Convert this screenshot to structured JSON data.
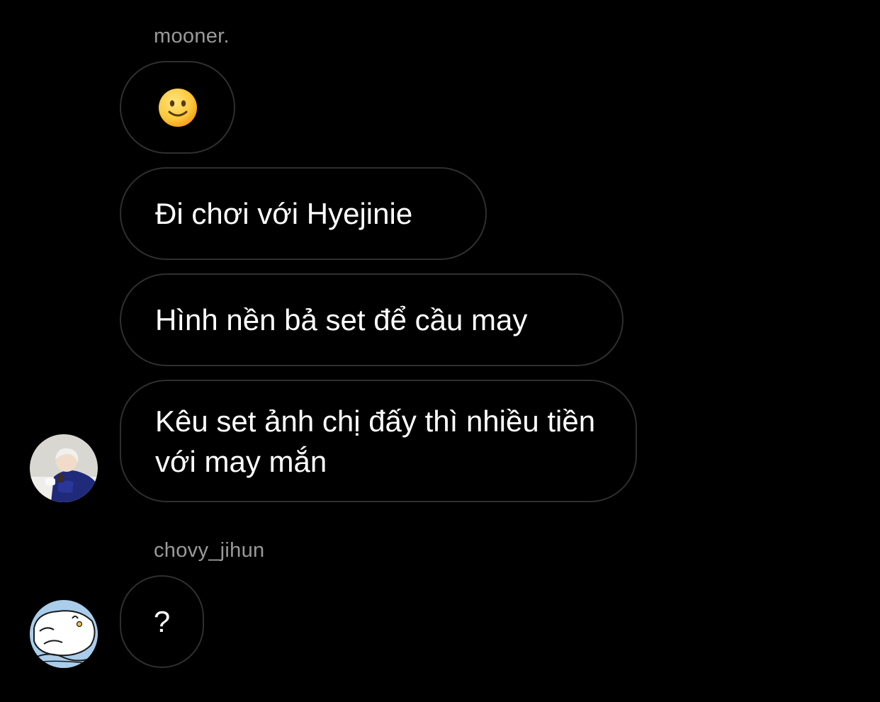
{
  "thread": {
    "groups": [
      {
        "sender": "mooner.",
        "messages": [
          {
            "type": "emoji",
            "icon": "slightly-smiling-face-emoji",
            "text": "🙂"
          },
          {
            "type": "text",
            "text": "Đi chơi với Hyejinie"
          },
          {
            "type": "text",
            "text": "Hình nền bả set để cầu may"
          },
          {
            "type": "text",
            "text": "Kêu set ảnh chị đấy thì nhiều tiền với may mắn"
          }
        ],
        "avatar": "mooner-avatar-photo"
      },
      {
        "sender": "chovy_jihun",
        "messages": [
          {
            "type": "text",
            "text": "?"
          }
        ],
        "avatar": "chovy-jihun-avatar-illustration"
      }
    ]
  },
  "colors": {
    "background": "#000000",
    "bubble_border": "#2f2f2f",
    "sender_name": "#9a9a9a",
    "message_text": "#ffffff"
  }
}
